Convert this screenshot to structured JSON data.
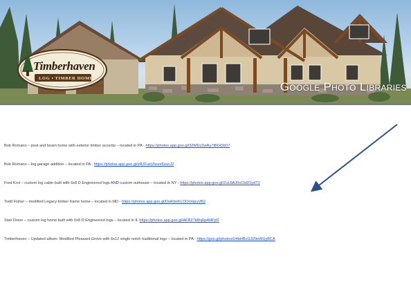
{
  "slide": {
    "title": "Google Photo Libraries",
    "logo": {
      "name": "Timberhaven",
      "subtitle": "LOG • TIMBER HOMES"
    }
  },
  "items": [
    {
      "description": "Bob Romano – post and beam home with exterior timber accents – located in PA - ",
      "link": "https://photos.app.goo.gl/3ZMDz2wRy7tBGCbD7"
    },
    {
      "description": "Bob Romano – log garage addition – located in PA - ",
      "link": "https://photos.app.goo.gl/zRJFusUhcex5zsnJ2"
    },
    {
      "description": "Fred Krol – custom log cabin built with 6x8 D Engineered logs AND custom outhouse – located in NY - ",
      "link": "https://photos.app.goo.gl/ZuL8AJ0vCbEOydT2"
    },
    {
      "description": "Todd Fisher – modified Legacy timber frame home – located in MD - ",
      "link": "https://photos.app.goo.gl/DwKboKLOOrmipuVB2"
    },
    {
      "description": "Stan Dixon – custom log home built with 6x8 D Engineered logs – located in IL ",
      "link": "https://photos.app.goo.gl/AFR27k8hj0g4MFyf2"
    },
    {
      "description": "Timberhaven – Updated album: Modified Pleasant Grove with 6x12 single notch traditional logs – located in PA - ",
      "link": "https://goo.gl/photos/U4bHBcG329oWUyBCA"
    }
  ],
  "annotation": {
    "arrow_color": "#2b4f8c",
    "points_to_item": 2
  }
}
